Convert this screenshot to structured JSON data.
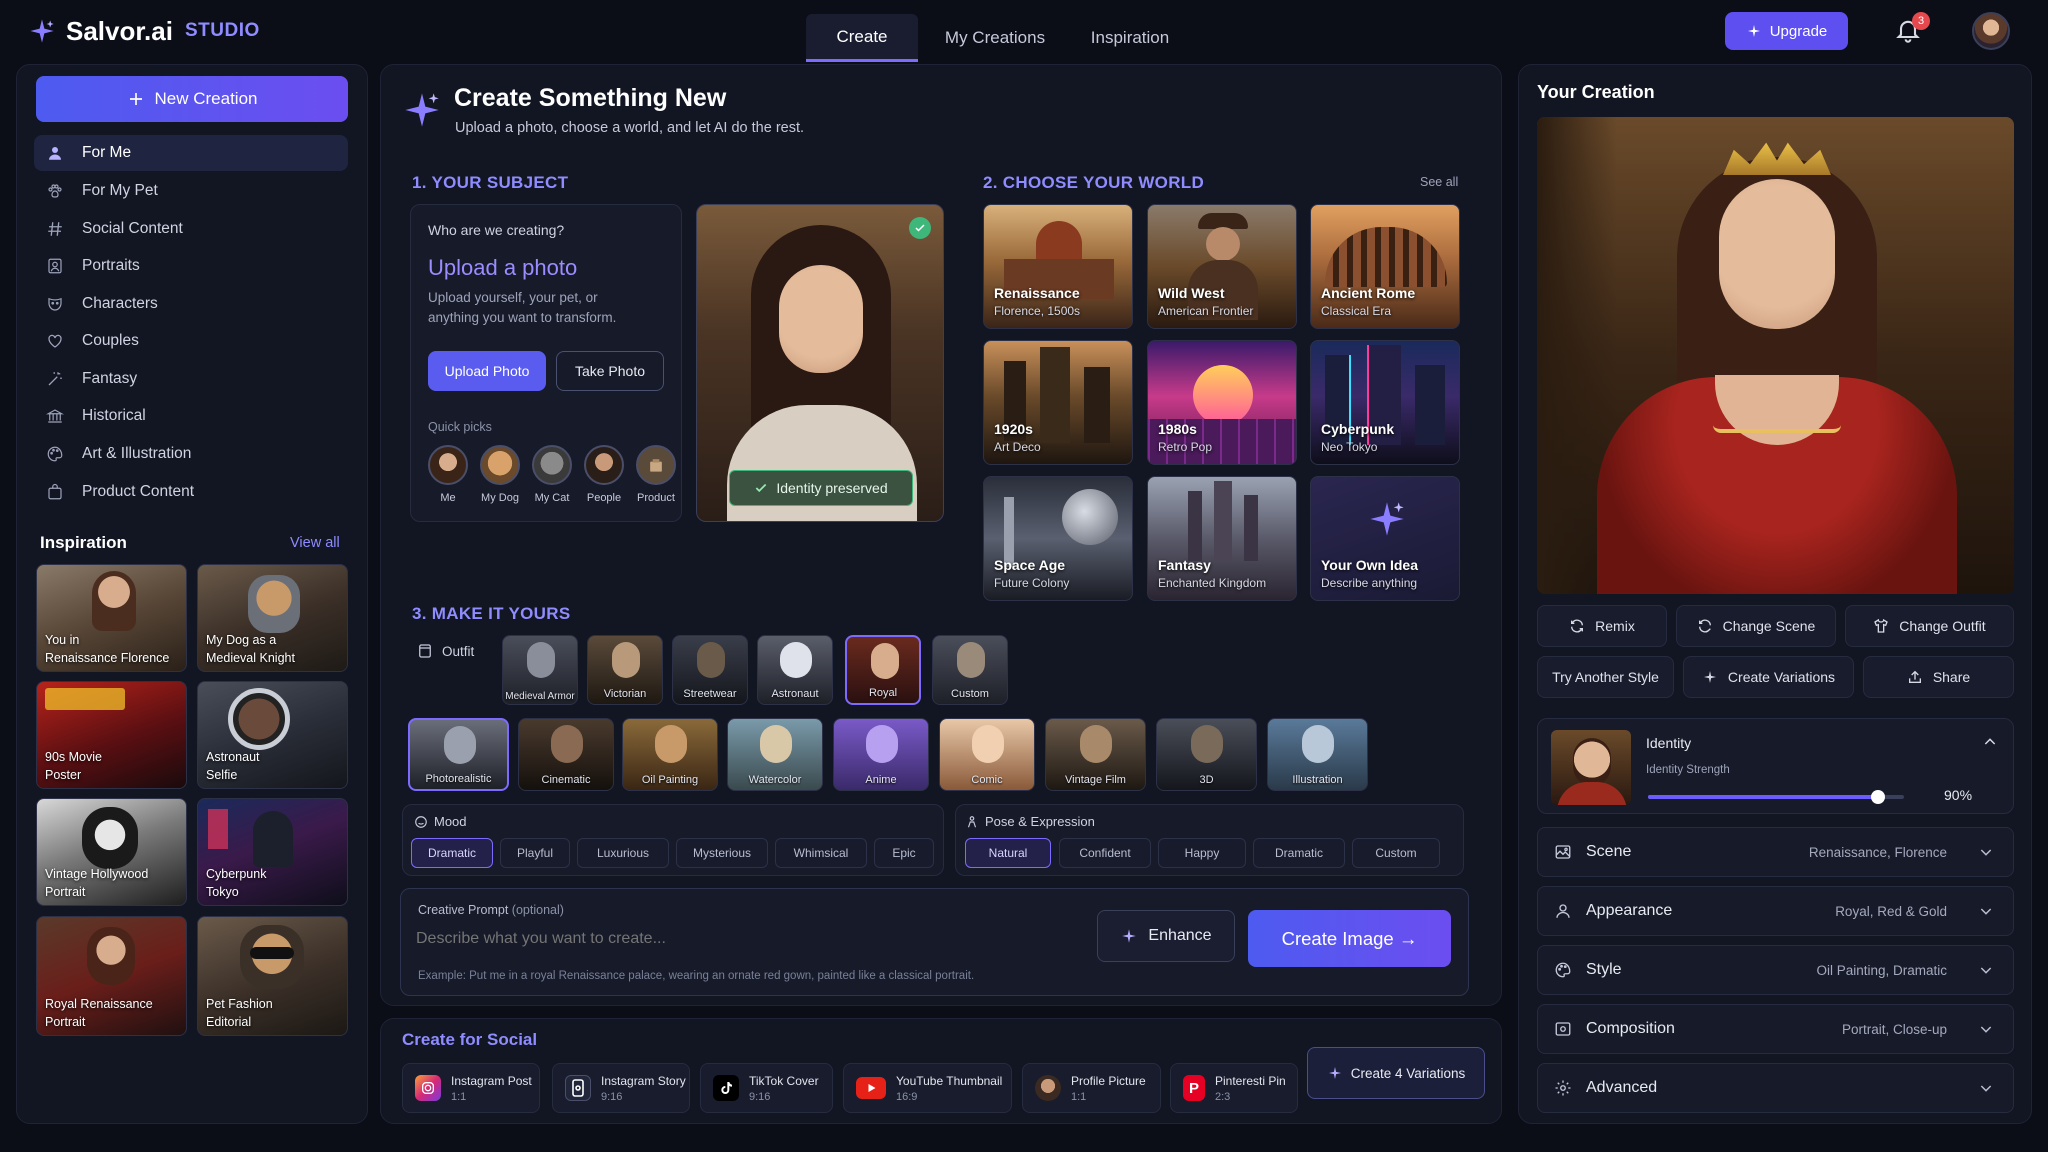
{
  "brand": {
    "name": "Salvor.ai",
    "studio": "STUDIO",
    "accent": "#6a5cff"
  },
  "topnav": {
    "tabs": [
      "Create",
      "My Creations",
      "Inspiration"
    ],
    "active": 0
  },
  "header": {
    "upgrade": "Upgrade",
    "notifications": "3"
  },
  "sidebar": {
    "new_creation": "New Creation",
    "items": [
      "For Me",
      "For My Pet",
      "Social Content",
      "Portraits",
      "Characters",
      "Couples",
      "Fantasy",
      "Historical",
      "Art & Illustration",
      "Product Content"
    ],
    "inspiration_title": "Inspiration",
    "view_all": "View all",
    "inspiration": [
      {
        "t": "You in",
        "s": "Renaissance Florence"
      },
      {
        "t": "My Dog as a",
        "s": "Medieval Knight"
      },
      {
        "t": "90s Movie",
        "s": "Poster"
      },
      {
        "t": "Astronaut",
        "s": "Selfie"
      },
      {
        "t": "Vintage Hollywood",
        "s": "Portrait"
      },
      {
        "t": "Cyberpunk",
        "s": "Tokyo"
      },
      {
        "t": "Royal Renaissance",
        "s": "Portrait"
      },
      {
        "t": "Pet Fashion",
        "s": "Editorial"
      }
    ]
  },
  "main": {
    "title": "Create Something New",
    "subtitle": "Upload a photo, choose a world, and let AI do the rest.",
    "subject": {
      "heading": "1. YOUR SUBJECT",
      "question": "Who are we creating?",
      "upload_title": "Upload a photo",
      "upload_desc_1": "Upload yourself, your pet, or",
      "upload_desc_2": "anything you want to transform.",
      "upload_btn": "Upload Photo",
      "take_btn": "Take Photo",
      "quick_picks": "Quick picks",
      "picks": [
        "Me",
        "My Dog",
        "My Cat",
        "People",
        "Product"
      ],
      "identity_badge": "Identity preserved"
    },
    "world": {
      "heading": "2. CHOOSE YOUR WORLD",
      "see_all": "See all",
      "items": [
        {
          "t": "Renaissance",
          "s": "Florence, 1500s"
        },
        {
          "t": "Wild West",
          "s": "American Frontier"
        },
        {
          "t": "Ancient Rome",
          "s": "Classical Era"
        },
        {
          "t": "1920s",
          "s": "Art Deco"
        },
        {
          "t": "1980s",
          "s": "Retro Pop"
        },
        {
          "t": "Cyberpunk",
          "s": "Neo Tokyo"
        },
        {
          "t": "Space Age",
          "s": "Future Colony"
        },
        {
          "t": "Fantasy",
          "s": "Enchanted Kingdom"
        },
        {
          "t": "Your Own Idea",
          "s": "Describe anything"
        }
      ]
    },
    "make": {
      "heading": "3. MAKE IT YOURS",
      "outfit_label": "Outfit",
      "outfits": [
        "Medieval Armor",
        "Victorian",
        "Streetwear",
        "Astronaut",
        "Royal",
        "Custom"
      ],
      "outfit_selected": 4,
      "styles": [
        "Photorealistic",
        "Cinematic",
        "Oil Painting",
        "Watercolor",
        "Anime",
        "Comic",
        "Vintage Film",
        "3D",
        "Illustration"
      ],
      "style_selected": 0,
      "mood_label": "Mood",
      "moods": [
        "Dramatic",
        "Playful",
        "Luxurious",
        "Mysterious",
        "Whimsical",
        "Epic"
      ],
      "pose_label": "Pose & Expression",
      "poses": [
        "Natural",
        "Confident",
        "Happy",
        "Dramatic",
        "Custom"
      ]
    },
    "prompt": {
      "label": "Creative Prompt",
      "optional": "(optional)",
      "placeholder": "Describe what you want to create...",
      "example_label": "Example:",
      "example": "Put me in a royal Renaissance palace, wearing an ornate red gown, painted like a classical portrait.",
      "enhance": "Enhance",
      "create": "Create Image →"
    },
    "social": {
      "title": "Create for Social",
      "items": [
        {
          "n": "Instagram Post",
          "r": "1:1"
        },
        {
          "n": "Instagram Story",
          "r": "9:16"
        },
        {
          "n": "TikTok Cover",
          "r": "9:16"
        },
        {
          "n": "YouTube Thumbnail",
          "r": "16:9"
        },
        {
          "n": "Profile Picture",
          "r": "1:1"
        },
        {
          "n": "Pinteresti Pin",
          "r": "2:3"
        }
      ],
      "variations": "Create 4 Variations"
    }
  },
  "result": {
    "title": "Your Creation",
    "actions": [
      "Remix",
      "Change Scene",
      "Change Outfit",
      "Try Another Style",
      "Create Variations",
      "Share"
    ],
    "identity_label": "Identity",
    "identity_strength_label": "Identity Strength",
    "identity_value": 90,
    "identity_value_text": "90%",
    "accordions": [
      {
        "n": "Scene",
        "v": "Renaissance, Florence"
      },
      {
        "n": "Appearance",
        "v": "Royal, Red & Gold"
      },
      {
        "n": "Style",
        "v": "Oil Painting, Dramatic"
      },
      {
        "n": "Composition",
        "v": "Portrait, Close-up"
      },
      {
        "n": "Advanced",
        "v": ""
      }
    ]
  }
}
